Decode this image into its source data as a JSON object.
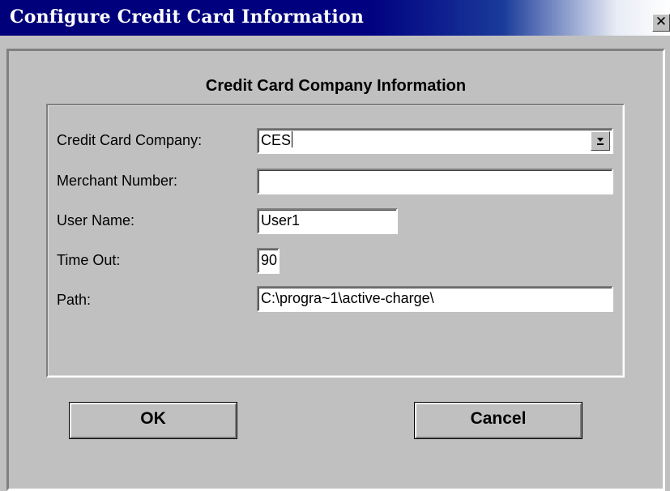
{
  "window": {
    "title": "Configure Credit Card Information",
    "close_icon": "close-icon",
    "close_glyph": "✕"
  },
  "group": {
    "title": "Credit Card Company Information"
  },
  "form": {
    "credit_card_company": {
      "label": "Credit Card  Company:",
      "value": "CES",
      "dropdown_icon": "chevron-down-icon"
    },
    "merchant_number": {
      "label": "Merchant Number:",
      "value": ""
    },
    "user_name": {
      "label": "User Name:",
      "value": "User1"
    },
    "time_out": {
      "label": "Time Out:",
      "value": "90"
    },
    "path": {
      "label": "Path:",
      "value": "C:\\progra~1\\active-charge\\"
    }
  },
  "buttons": {
    "ok_label": "OK",
    "cancel_label": "Cancel"
  },
  "colors": {
    "titlebar": "#000080",
    "face": "#c0c0c0",
    "field": "#ffffff"
  }
}
